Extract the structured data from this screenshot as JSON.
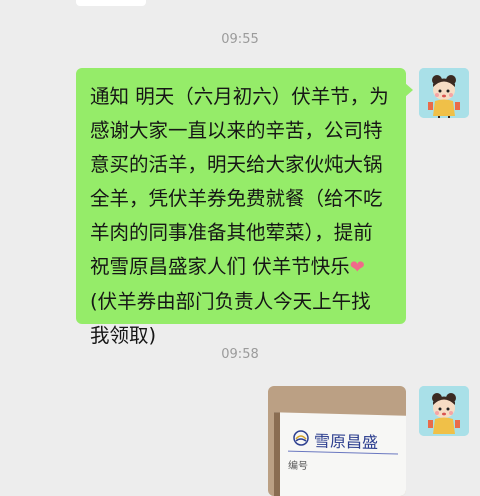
{
  "messages": [
    {
      "timestamp": "09:55",
      "sender": "self",
      "type": "text",
      "text": "通知 明天（六月初六）伏羊节，为\n感谢大家一直以来的辛苦，公司特\n意买的活羊，明天给大家伙炖大锅\n全羊，凭伏羊券免费就餐（给不吃\n羊肉的同事准备其他荤菜），提前\n祝雪原昌盛家人们 伏羊节快乐",
      "emoji": "❤",
      "text_after": "\n(伏羊券由部门负责人今天上午找\n我领取)"
    },
    {
      "timestamp": "09:58",
      "sender": "self",
      "type": "image",
      "image_text": "雪原昌盛",
      "image_subtext": "编号"
    }
  ],
  "colors": {
    "background": "#ededed",
    "self_bubble": "#95ec69",
    "avatar_bg": "#a9e0e8",
    "timestamp": "#9b9b9b"
  },
  "icons": {
    "avatar": "cartoon-child-avatar-icon",
    "heart": "red-heart-emoji"
  }
}
